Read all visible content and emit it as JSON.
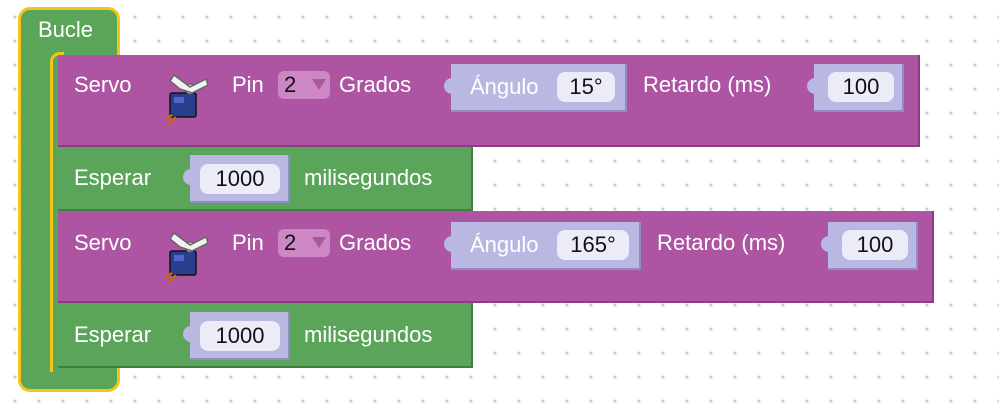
{
  "loop": {
    "label": "Bucle"
  },
  "blocks": [
    {
      "type": "servo",
      "servo_label": "Servo",
      "pin_label": "Pin",
      "pin_value": "2",
      "degrees_label": "Grados",
      "angle_label": "Ángulo",
      "angle_value": "15°",
      "delay_label": "Retardo (ms)",
      "delay_value": "100",
      "icon": "servo-motor-icon"
    },
    {
      "type": "wait",
      "wait_label": "Esperar",
      "wait_value": "1000",
      "unit_label": "milisegundos"
    },
    {
      "type": "servo",
      "servo_label": "Servo",
      "pin_label": "Pin",
      "pin_value": "2",
      "degrees_label": "Grados",
      "angle_label": "Ángulo",
      "angle_value": "165°",
      "delay_label": "Retardo (ms)",
      "delay_value": "100",
      "icon": "servo-motor-icon"
    },
    {
      "type": "wait",
      "wait_label": "Esperar",
      "wait_value": "1000",
      "unit_label": "milisegundos"
    }
  ],
  "colors": {
    "servo_block": "#ad55a3",
    "wait_block": "#5ba55b",
    "loop_highlight": "#f5c518",
    "input_slot": "#b8b8e3",
    "grid_dot": "#a9d8c9"
  }
}
